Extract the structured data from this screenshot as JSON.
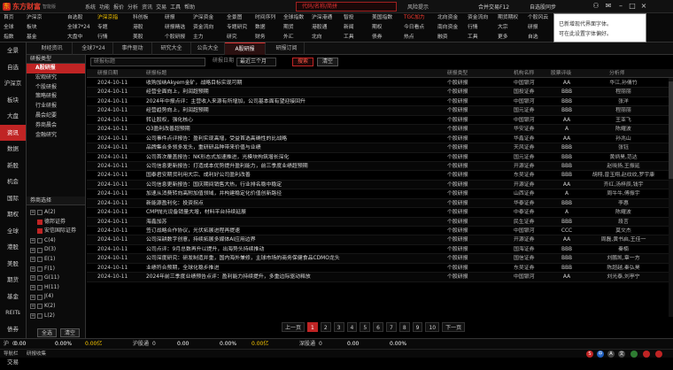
{
  "app": {
    "logo_text": "东方财富",
    "logo_sub": "智能版",
    "menu": [
      "系统",
      "功能",
      "报价",
      "分析",
      "资讯",
      "交易",
      "工具",
      "帮助"
    ],
    "search_placeholder": "代码/名称/简拼",
    "warn_label": "风险提示",
    "toolbar_btns": [
      "合并交易F12",
      "自选股同步"
    ],
    "colors": {
      "accent": "#c02424",
      "warn": "#ff3b30",
      "highlight": "#ffcc00",
      "text": "#cccccc"
    }
  },
  "nav": {
    "cols": [
      [
        "首页",
        "全球",
        "指数"
      ],
      [
        "沪深京",
        "板块",
        "基金"
      ],
      [
        "自选股",
        "全球7*24",
        "大盘中"
      ],
      [
        "沪深京指",
        "专题",
        "行情"
      ],
      [
        "科创板",
        "港股",
        "美股"
      ],
      [
        "研报",
        "研报精选",
        "个股研报"
      ],
      [
        "沪深资金",
        "资金流向",
        "主力"
      ],
      [
        "全景图",
        "专题研究",
        "研究"
      ],
      [
        "时间序列",
        "数据",
        "财务"
      ],
      [
        "全球指数",
        "期货",
        "外汇"
      ],
      [
        "沪深港通",
        "港股通",
        "北向"
      ],
      [
        "智投",
        "新闻",
        "工具"
      ],
      [
        "美国指数",
        "期权",
        "债券"
      ],
      [
        "TGC加力",
        "今日看点",
        "热点"
      ],
      [
        "北向资金",
        "南向资金",
        "融资"
      ],
      [
        "资金流向",
        "行情",
        "工具"
      ],
      [
        "期货期权",
        "大宗",
        "更多"
      ],
      [
        "个股风云",
        "研报",
        "自选"
      ],
      [
        "7*24小时",
        "资讯",
        "专题"
      ]
    ],
    "hl": "沪深京指",
    "popup_lines": [
      "已新增现代界面字体。",
      "可在此设置字体偏好。"
    ]
  },
  "sidebar": [
    "全景",
    "自选",
    "沪深京",
    "板块",
    "大盘",
    "资讯",
    "数据",
    "新股",
    "机会",
    "国际",
    "期权",
    "全球",
    "港股",
    "美股",
    "期货",
    "基金",
    "REITs",
    "债券",
    "外汇",
    "交易"
  ],
  "sidebar_active": "资讯",
  "tabs": [
    {
      "label": "财经资讯"
    },
    {
      "label": "全球7*24"
    },
    {
      "label": "事件驱动"
    },
    {
      "label": "研究大全"
    },
    {
      "label": "公告大全"
    },
    {
      "label": "A股研报"
    },
    {
      "label": "研报订阅"
    }
  ],
  "tab_active": 5,
  "categories": {
    "head": "研报类型",
    "items": [
      "A股研报",
      "宏观研究",
      "个股研报",
      "策略研报",
      "行业研报",
      "晨会纪要",
      "券商晨会",
      "金融研究"
    ],
    "active": "A股研报"
  },
  "orgs": {
    "head": "券商选择",
    "items": [
      {
        "label": "A(2)",
        "checked": false,
        "group": true
      },
      {
        "label": "德邦证券",
        "checked": true,
        "group": false
      },
      {
        "label": "安信国际证券",
        "checked": true,
        "group": false
      },
      {
        "label": "C(4)",
        "checked": false,
        "group": true
      },
      {
        "label": "D(3)",
        "checked": false,
        "group": true
      },
      {
        "label": "E(1)",
        "checked": false,
        "group": true
      },
      {
        "label": "F(1)",
        "checked": false,
        "group": true
      },
      {
        "label": "G(11)",
        "checked": false,
        "group": true
      },
      {
        "label": "H(11)",
        "checked": false,
        "group": true
      },
      {
        "label": "J(4)",
        "checked": false,
        "group": true
      },
      {
        "label": "K(2)",
        "checked": false,
        "group": true
      },
      {
        "label": "L(2)",
        "checked": false,
        "group": true
      }
    ],
    "btn_all": "全选",
    "btn_clear": "清空"
  },
  "filter": {
    "keyword_placeholder": "研报标题",
    "date_label": "研报日期",
    "range_value": "最近三个月",
    "query_btn": "搜索",
    "reset_btn": "清空"
  },
  "columns": [
    "研报日期",
    "研报标题",
    "研报类型",
    "机构名称",
    "股票评级",
    "分析师"
  ],
  "rows": [
    {
      "date": "2024-10-11",
      "title": "收购加纳Akyem金矿，战略目标实现可期",
      "type": "个股研报",
      "org": "中国银河",
      "rate": "AA",
      "anl": "华江,孙倩竹"
    },
    {
      "date": "2024-10-11",
      "title": "经营全面向上，利润超预期",
      "type": "个股研报",
      "org": "国投证券",
      "rate": "BBB",
      "anl": "程丽丽"
    },
    {
      "date": "2024-10-11",
      "title": "2024年中报点评：主营收入来源有所增加，公司基本面有望迎接回升",
      "type": "个股研报",
      "org": "中国银河",
      "rate": "BBB",
      "anl": "张洋"
    },
    {
      "date": "2024-10-11",
      "title": "经营趋势向上，利润超预期",
      "type": "个股研报",
      "org": "国元证券",
      "rate": "BBB",
      "anl": "程丽丽"
    },
    {
      "date": "2024-10-11",
      "title": "转让股权，强化核心",
      "type": "个股研报",
      "org": "中国银河",
      "rate": "AA",
      "anl": "王亚飞"
    },
    {
      "date": "2024-10-11",
      "title": "Q3盈利改善超预期",
      "type": "个股研报",
      "org": "华安证券",
      "rate": "A",
      "anl": "陈耀波"
    },
    {
      "date": "2024-10-11",
      "title": "公司事件点评报告：盈利实现高增，受益首选高确性的比战略",
      "type": "个股研报",
      "org": "华鑫证券",
      "rate": "AA",
      "anl": "孙兆山"
    },
    {
      "date": "2024-10-11",
      "title": "品牌集合多领多发头，重研研品种带来价值与业绩",
      "type": "个股研报",
      "org": "天风证券",
      "rate": "BBB",
      "anl": "张钰"
    },
    {
      "date": "2024-10-11",
      "title": "公司首次覆盖报告：NK形态式加速推进，光模块构筑增长深化",
      "type": "个股研报",
      "org": "国元证券",
      "rate": "BBB",
      "anl": "黄炳昊,范达"
    },
    {
      "date": "2024-10-11",
      "title": "公司信息更新报告：打造成本优势提升盈利能力，前三季度业绩超预期",
      "type": "个股研报",
      "org": "开源证券",
      "rate": "BBB",
      "anl": "赵晓扬,王振延"
    },
    {
      "date": "2024-10-11",
      "title": "国泰君安期货利用大宗、成利好公司盈利改善",
      "type": "个股研报",
      "org": "东吴证券",
      "rate": "BBB",
      "anl": "胡翔,曾玉翔,赵纹纹,罗宇康"
    },
    {
      "date": "2024-10-11",
      "title": "公司信息更新报告：国庆期间销售大热，行业排名稳中稳定",
      "type": "个股研报",
      "org": "开源证券",
      "rate": "AA",
      "anl": "齐红,汤梓辰,钱宇"
    },
    {
      "date": "2024-10-11",
      "title": "加速从消费转向高附加值领域，并构建稳定化价值创新路径",
      "type": "个股研报",
      "org": "山西证券",
      "rate": "A",
      "anl": "周牛牛,傅振宇"
    },
    {
      "date": "2024-10-11",
      "title": "新能源盈利化：投资拐点",
      "type": "个股研报",
      "org": "华泰证券",
      "rate": "BBB",
      "anl": "李惠"
    },
    {
      "date": "2024-10-11",
      "title": "CMP抛光设备销量大增，材料平台持续延展",
      "type": "个股研报",
      "org": "中泰证券",
      "rate": "A",
      "anl": "陈耀波"
    },
    {
      "date": "2024-10-11",
      "title": "海鑫加苏",
      "type": "个股研报",
      "org": "民生证券",
      "rate": "BBB",
      "anl": "段言"
    },
    {
      "date": "2024-10-11",
      "title": "签订战略合作协议，光伏拓展进程再提速",
      "type": "个股研报",
      "org": "中国银河",
      "rate": "CCC",
      "anl": "莫文杰"
    },
    {
      "date": "2024-10-11",
      "title": "公司深耕数字创意，持续拓展多媒体AI应用边界",
      "type": "个股研报",
      "org": "开源证券",
      "rate": "AA",
      "anl": "周磊,黄书启,王佳一"
    },
    {
      "date": "2024-10-11",
      "title": "公司点评：9月总数再升以提升，出海势头持续推动",
      "type": "个股研报",
      "org": "国海证券",
      "rate": "BBB",
      "anl": "秦楠"
    },
    {
      "date": "2024-10-11",
      "title": "公司深度研究：研发制造并重，国内海外兼修，主球市场的商务保健食品CDMO龙头",
      "type": "个股研报",
      "org": "国信证券",
      "rate": "BBB",
      "anl": "刘鹏凯,章一方"
    },
    {
      "date": "2024-10-11",
      "title": "业绩符合预期，全球化稳步推进",
      "type": "个股研报",
      "org": "东吴证券",
      "rate": "BBB",
      "anl": "陈超越,秦弘昊"
    },
    {
      "date": "2024-10-11",
      "title": "2024年前三季度业绩预告点评：盈利能力持续提升，多重边际驱动释放",
      "type": "个股研报",
      "org": "中国银河",
      "rate": "AA",
      "anl": "刘光泰,刘亭宁"
    }
  ],
  "pager": {
    "prev": "上一页",
    "pages": [
      "1",
      "2",
      "3",
      "4",
      "5",
      "6",
      "7",
      "8",
      "9",
      "10"
    ],
    "active": "1",
    "next": "下一页"
  },
  "status": [
    {
      "label": "沪",
      "value": "0",
      "color": "#cccccc"
    },
    {
      "label": "",
      "value": "0.00",
      "color": "#ffffff"
    },
    {
      "label": "",
      "value": "0.00%",
      "color": "#ffffff"
    },
    {
      "label": "",
      "value": "0.00亿",
      "color": "#ffcc00"
    },
    {
      "label": "沪股通",
      "value": "0",
      "color": "#cccccc"
    },
    {
      "label": "",
      "value": "0.00",
      "color": "#ffffff"
    },
    {
      "label": "",
      "value": "0.00%",
      "color": "#ffffff"
    },
    {
      "label": "",
      "value": "0.00亿",
      "color": "#ffcc00"
    },
    {
      "label": "深股通",
      "value": "0",
      "color": "#cccccc"
    },
    {
      "label": "",
      "value": "0.00",
      "color": "#ffffff"
    },
    {
      "label": "",
      "value": "0.00%",
      "color": "#ffffff"
    }
  ],
  "footer": {
    "left": [
      "导航栏",
      "研报收集"
    ],
    "right_labels": [
      "S",
      "中",
      "A",
      "文"
    ]
  }
}
